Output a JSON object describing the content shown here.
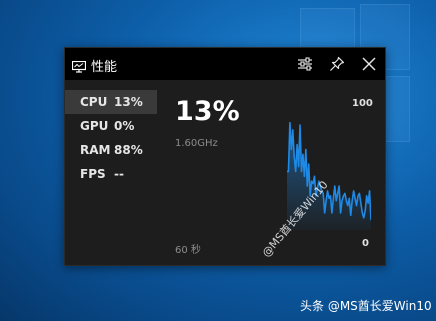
{
  "widget": {
    "title": "性能",
    "icon": "monitor-icon"
  },
  "toolbar": {
    "settings_icon": "sliders-icon",
    "pin_icon": "pin-icon",
    "close_icon": "close-icon"
  },
  "metrics": [
    {
      "name": "CPU",
      "value": "13%",
      "active": true
    },
    {
      "name": "GPU",
      "value": "0%",
      "active": false
    },
    {
      "name": "RAM",
      "value": "88%",
      "active": false
    },
    {
      "name": "FPS",
      "value": "--",
      "active": false
    }
  ],
  "detail": {
    "big_value": "13%",
    "frequency": "1.60GHz",
    "time_window": "60 秒",
    "axis_max": "100",
    "axis_min": "0"
  },
  "chart_data": {
    "type": "area",
    "ylim": [
      0,
      100
    ],
    "values": [
      48,
      48,
      88,
      66,
      82,
      60,
      48,
      70,
      52,
      86,
      48,
      62,
      44,
      66,
      36,
      54,
      28,
      40,
      38,
      44,
      28,
      34,
      40,
      36,
      32,
      30,
      14,
      24,
      32,
      26,
      28,
      14,
      26,
      36,
      24,
      30,
      36,
      14,
      24,
      28,
      30,
      24,
      20,
      26,
      12,
      24,
      32,
      26,
      20,
      28,
      30,
      22,
      14,
      10,
      16,
      28,
      22,
      32,
      8
    ],
    "color": "#1f8ae6"
  },
  "watermarks": {
    "diagonal": "@MS酋长爱Win10",
    "bottom": "头条 @MS酋长爱Win10"
  }
}
